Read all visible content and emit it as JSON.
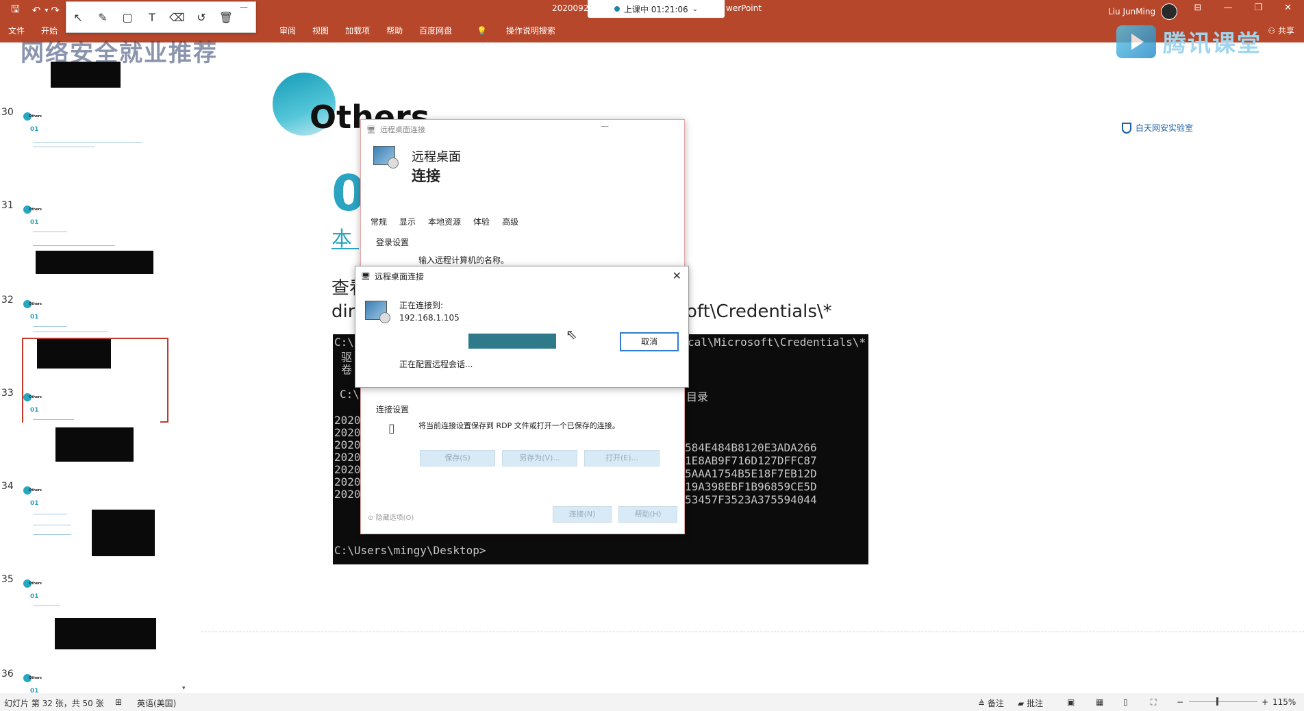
{
  "titlebar": {
    "doc_title": "2020092",
    "session": "上课中 01:21:06",
    "app_tail": "werPoint",
    "user": "Liu JunMing",
    "share": "共享"
  },
  "menu": [
    "文件",
    "开始",
    "审阅",
    "视图",
    "加载项",
    "帮助",
    "百度网盘",
    "操作说明搜索"
  ],
  "watermark": {
    "title": "网络安全就业推荐",
    "brand": "腾讯课堂"
  },
  "thumbnails": {
    "numbers": [
      "30",
      "31",
      "32",
      "33",
      "34",
      "35",
      "36"
    ],
    "logo_text": "Others",
    "section": "01",
    "selected": "32"
  },
  "slide": {
    "heading": "Others",
    "number": "0",
    "subtitle": "本",
    "line1": "查看",
    "line2_start": "dir",
    "line2_end": "oft\\Credentials\\*",
    "partner": "白天网安实验室"
  },
  "console": {
    "line_top": "C:\\",
    "line_top_tail": "cal\\Microsoft\\Credentials\\*",
    "line_a": "驱",
    "line_b": "卷",
    "line_c": "C:\\",
    "line_c_tail": "目录",
    "dates": [
      "2020",
      "2020",
      "2020",
      "2020",
      "2020",
      "2020",
      "2020"
    ],
    "hashes": [
      "584E484B8120E3ADA266",
      "1E8AB9F716D127DFFC87",
      "5AAA1754B5E18F7EB12D",
      "19A398EBF1B96859CE5D",
      "53457F3523A375594044"
    ],
    "prompt": "C:\\Users\\mingy\\Desktop>"
  },
  "rdc_main": {
    "title": "远程桌面连接",
    "heading1": "远程桌面",
    "heading2": "连接",
    "tabs": [
      "常规",
      "显示",
      "本地资源",
      "体验",
      "高级"
    ],
    "login_section": "登录设置",
    "login_hint": "输入远程计算机的名称。",
    "conn_section": "连接设置",
    "conn_hint": "将当前连接设置保存到 RDP 文件或打开一个已保存的连接。",
    "btn_save": "保存(S)",
    "btn_saveas": "另存为(V)...",
    "btn_open": "打开(E)...",
    "btn_hide": "隐藏选项(O)",
    "btn_connect": "连接(N)",
    "btn_help": "帮助(H)"
  },
  "rdc_connecting": {
    "title": "远程桌面连接",
    "label": "正在连接到:",
    "host": "192.168.1.105",
    "status": "正在配置远程会话...",
    "progress": 1.0,
    "cancel": "取消"
  },
  "statusbar": {
    "slide_info": "幻灯片 第 32 张，共 50 张",
    "language": "英语(美国)",
    "notes": "备注",
    "comments": "批注",
    "zoom": "115%"
  },
  "colors": {
    "ribbon": "#b7472a",
    "accent": "#2aa4c0",
    "console_bg": "#0c0c0c"
  }
}
